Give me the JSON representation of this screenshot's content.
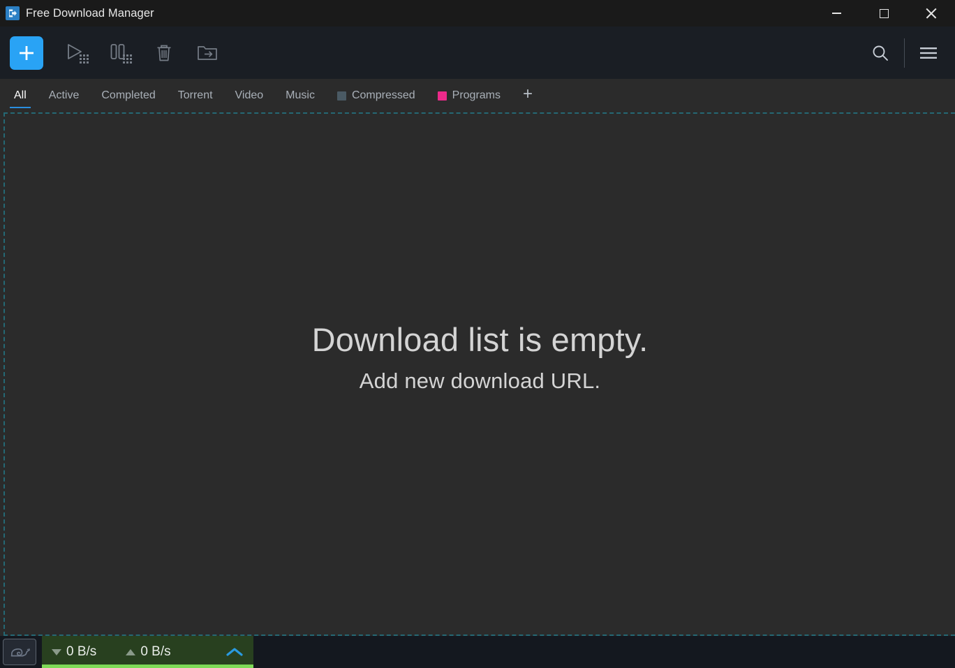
{
  "window": {
    "title": "Free Download Manager",
    "app_icon": "download-arrow-icon",
    "controls": {
      "minimize": "minimize-button",
      "maximize": "maximize-button",
      "close": "close-button"
    }
  },
  "toolbar": {
    "add_label": "+",
    "buttons": [
      {
        "name": "add-download-button",
        "icon": "plus-icon"
      },
      {
        "name": "resume-all-button",
        "icon": "play-all-icon"
      },
      {
        "name": "pause-all-button",
        "icon": "pause-all-icon"
      },
      {
        "name": "delete-button",
        "icon": "trash-icon"
      },
      {
        "name": "move-to-folder-button",
        "icon": "folder-arrow-icon"
      }
    ],
    "search_icon": "search-icon",
    "menu_icon": "hamburger-menu-icon"
  },
  "tabs": {
    "active": "All",
    "items": [
      {
        "label": "All",
        "chip": null
      },
      {
        "label": "Active",
        "chip": null
      },
      {
        "label": "Completed",
        "chip": null
      },
      {
        "label": "Torrent",
        "chip": null
      },
      {
        "label": "Video",
        "chip": null
      },
      {
        "label": "Music",
        "chip": null
      },
      {
        "label": "Compressed",
        "chip": "#4a5a64"
      },
      {
        "label": "Programs",
        "chip": "#ec2a8a"
      }
    ],
    "add_tab_label": "+"
  },
  "main": {
    "empty_title": "Download list is empty.",
    "empty_subtitle": "Add new download URL."
  },
  "statusbar": {
    "speed_limiter_icon": "snail-icon",
    "download_speed": "0 B/s",
    "upload_speed": "0 B/s",
    "download_arrow": "triangle-down-icon",
    "upload_arrow": "triangle-up-icon",
    "expand_icon": "chevron-up-icon"
  },
  "colors": {
    "accent": "#29a3f5",
    "titlebar_bg": "#1a1a1a",
    "toolbar_bg": "#1a1e24",
    "content_bg": "#2b2b2b",
    "statusbar_bg": "#14181f",
    "speed_panel_bg": "#28401f",
    "speed_bar": "#7ed957",
    "dashed_grid": "#256874",
    "programs_chip": "#ec2a8a",
    "compressed_chip": "#4a5a64"
  }
}
